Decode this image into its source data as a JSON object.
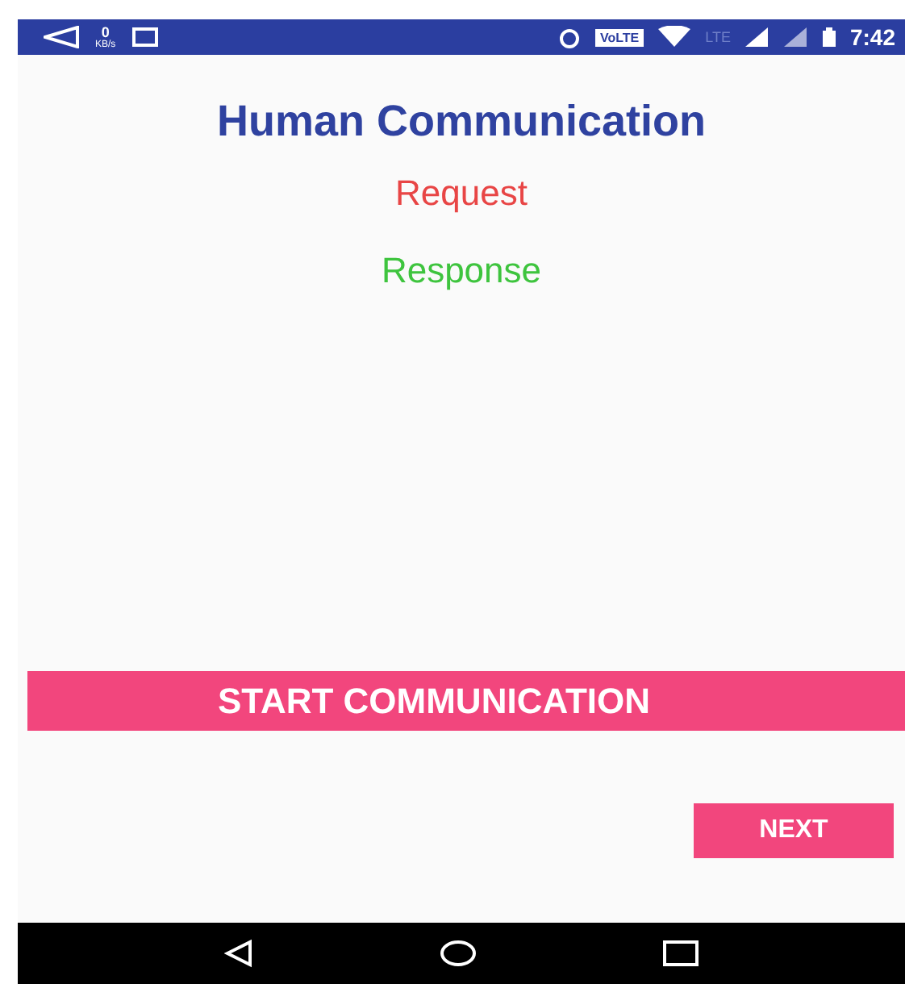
{
  "status_bar": {
    "speed_value": "0",
    "speed_unit": "KB/s",
    "badge": "VoLTE",
    "network": "LTE",
    "time": "7:42"
  },
  "title": "Human Communication",
  "request": "Request",
  "response": "Response",
  "start_button": "START COMMUNICATION",
  "next_button": "NEXT"
}
